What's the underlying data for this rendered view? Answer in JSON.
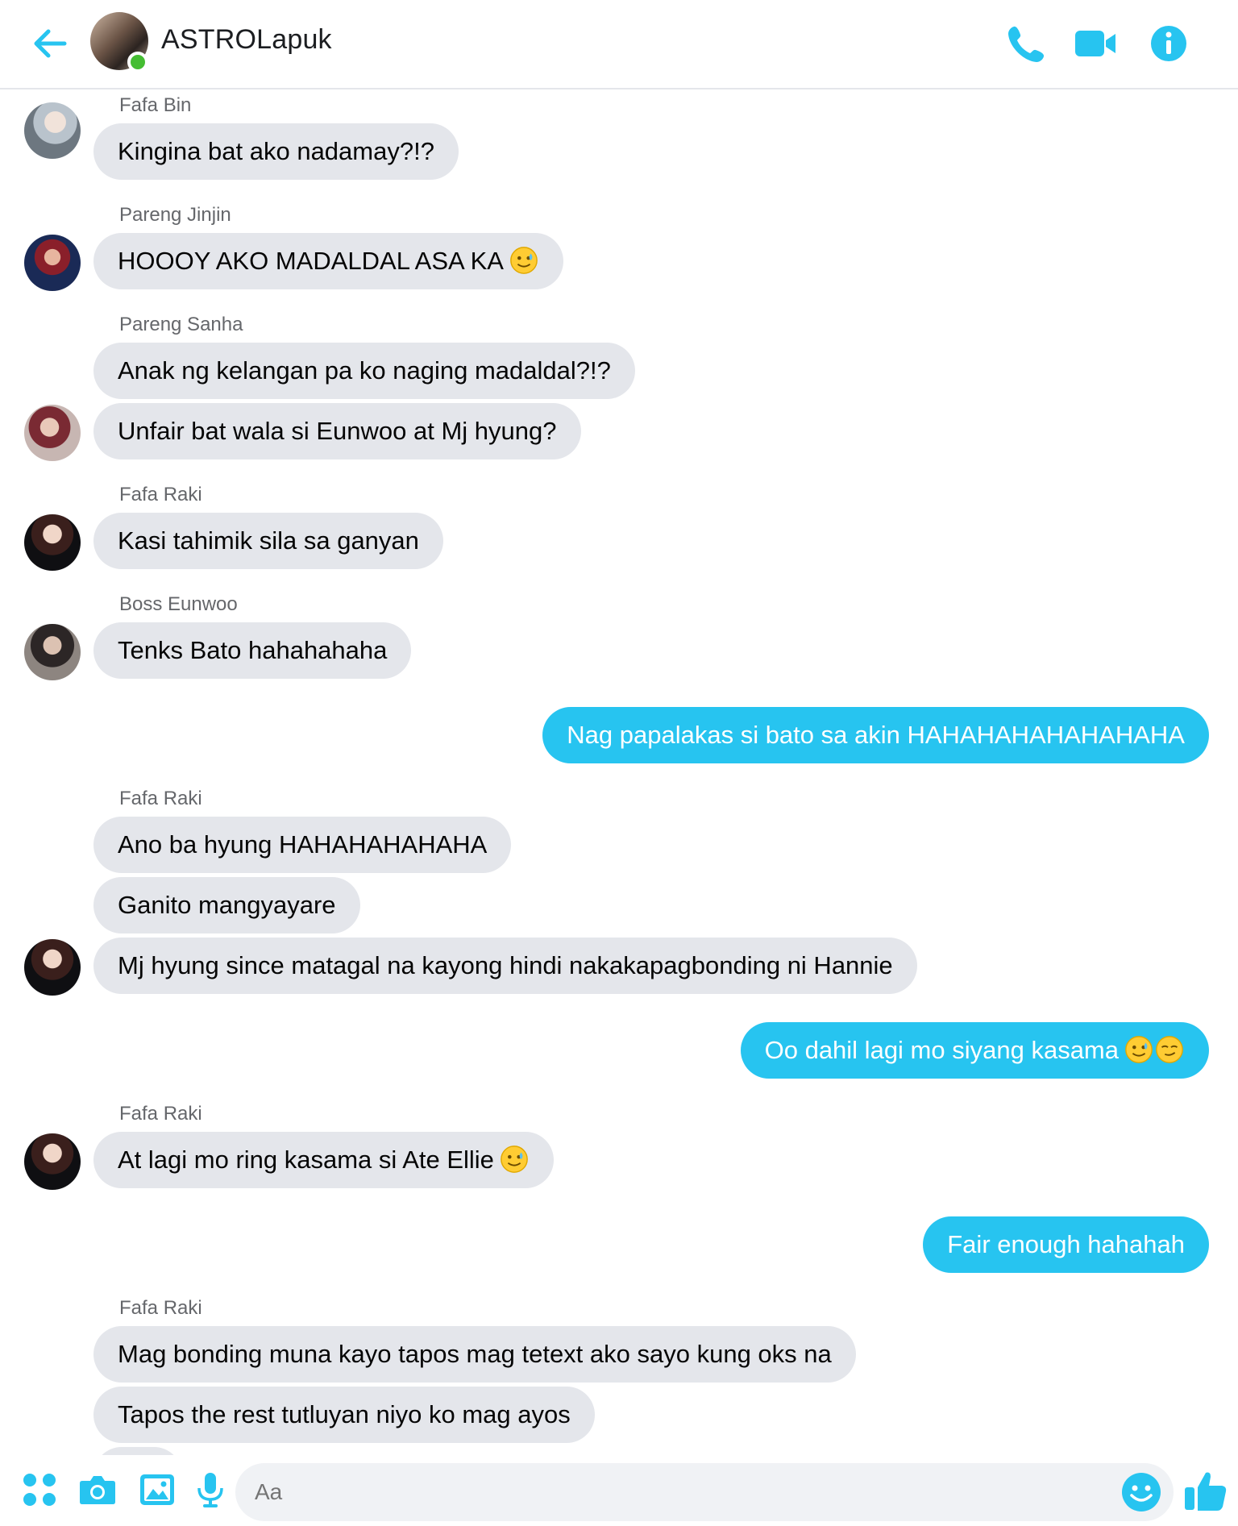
{
  "header": {
    "title": "ASTROLapuk",
    "back_icon": "arrow-left-icon",
    "call_icon": "phone-icon",
    "video_icon": "video-camera-icon",
    "info_icon": "info-icon",
    "accent_color": "#27c4f0",
    "online_color": "#44bd32"
  },
  "thread": {
    "incoming_bubble_color": "#e4e6eb",
    "outgoing_bubble_color": "#27c4f0",
    "messages": [
      {
        "sender": "Fafa Bin",
        "text": "Kingina bat ako nadamay?!?"
      },
      {
        "sender": "Pareng Jinjin",
        "text": "HOOOY AKO MADALDAL ASA KA"
      },
      {
        "sender": "Pareng Sanha",
        "text": "Anak ng kelangan pa ko naging madaldal?!?"
      },
      {
        "text": "Unfair bat wala si Eunwoo at Mj hyung?"
      },
      {
        "sender": "Fafa Raki",
        "text": "Kasi tahimik sila sa ganyan"
      },
      {
        "sender": "Boss Eunwoo",
        "text": "Tenks Bato hahahahaha"
      },
      {
        "text": "Nag papalakas si bato sa akin HAHAHAHAHAHAHAHA",
        "outgoing": true
      },
      {
        "sender": "Fafa Raki",
        "text": "Ano ba hyung HAHAHAHAHAHA"
      },
      {
        "text": "Ganito mangyayare"
      },
      {
        "text": "Mj hyung since matagal na kayong hindi nakakapagbonding ni Hannie"
      },
      {
        "text": "Oo dahil lagi mo siyang kasama",
        "outgoing": true
      },
      {
        "sender": "Fafa Raki",
        "text": "At lagi mo ring kasama si Ate Ellie"
      },
      {
        "text": "Fair enough hahahah",
        "outgoing": true
      },
      {
        "sender": "Fafa Raki",
        "text": "Mag bonding muna kayo tapos mag tetext ako sayo kung oks na"
      },
      {
        "text": "Tapos the rest tutluyan niyo ko mag ayos"
      }
    ]
  },
  "composer": {
    "placeholder": "Aa",
    "icons": [
      "apps-icon",
      "camera-icon",
      "image-icon",
      "microphone-icon",
      "smile-icon",
      "thumbs-up-icon"
    ]
  }
}
